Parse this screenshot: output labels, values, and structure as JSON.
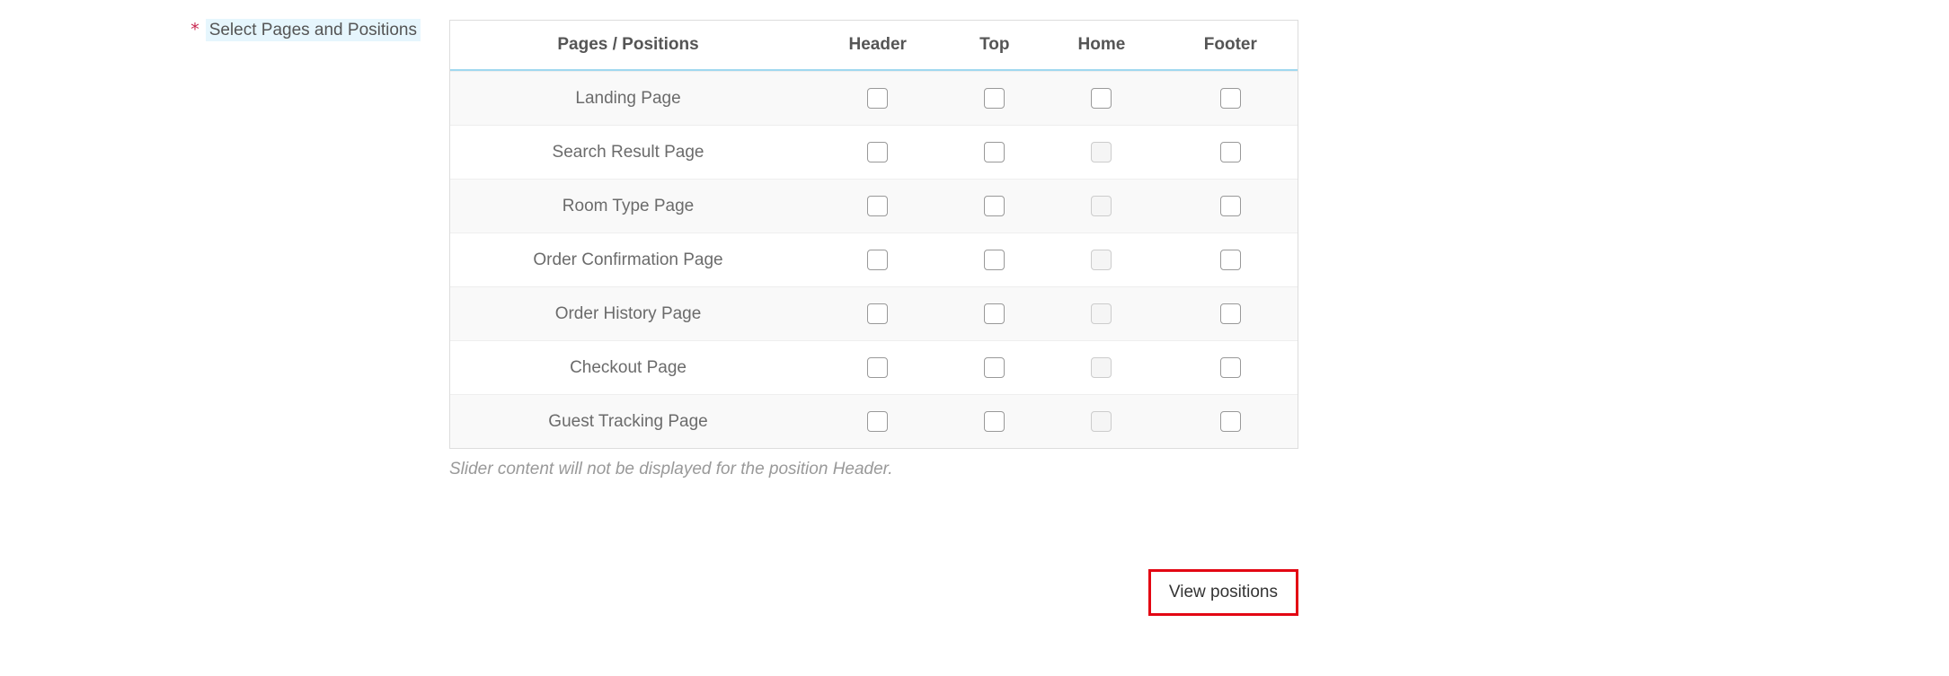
{
  "label": {
    "required_mark": "*",
    "text": "Select Pages and Positions"
  },
  "table": {
    "headers": [
      "Pages / Positions",
      "Header",
      "Top",
      "Home",
      "Footer"
    ],
    "rows": [
      {
        "page": "Landing Page",
        "header": false,
        "top": false,
        "home": false,
        "home_disabled": false,
        "footer": false
      },
      {
        "page": "Search Result Page",
        "header": false,
        "top": false,
        "home": false,
        "home_disabled": true,
        "footer": false
      },
      {
        "page": "Room Type Page",
        "header": false,
        "top": false,
        "home": false,
        "home_disabled": true,
        "footer": false
      },
      {
        "page": "Order Confirmation Page",
        "header": false,
        "top": false,
        "home": false,
        "home_disabled": true,
        "footer": false
      },
      {
        "page": "Order History Page",
        "header": false,
        "top": false,
        "home": false,
        "home_disabled": true,
        "footer": false
      },
      {
        "page": "Checkout Page",
        "header": false,
        "top": false,
        "home": false,
        "home_disabled": true,
        "footer": false
      },
      {
        "page": "Guest Tracking Page",
        "header": false,
        "top": false,
        "home": false,
        "home_disabled": true,
        "footer": false
      }
    ]
  },
  "note": "Slider content will not be displayed for the position Header.",
  "view_positions_label": "View positions"
}
